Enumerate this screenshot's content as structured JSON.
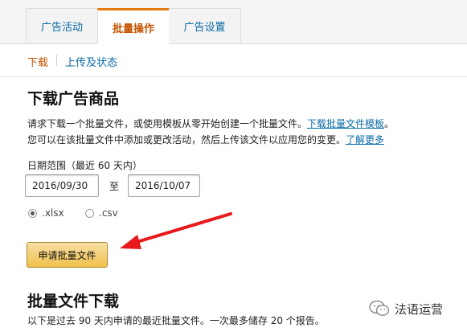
{
  "tabs": [
    {
      "label": "广告活动"
    },
    {
      "label": "批量操作"
    },
    {
      "label": "广告设置"
    }
  ],
  "subnav": {
    "active": "下载",
    "other": "上传及状态"
  },
  "download_section": {
    "title": "下载广告商品",
    "desc1_text": "请求下载一个批量文件，或使用模板从零开始创建一个批量文件。",
    "desc1_link": "下载批量文件模板",
    "desc1_tail": "。",
    "desc2_text": "您可以在该批量文件中添加或更改活动，然后上传该文件以应用您的变更。",
    "desc2_link": "了解更多",
    "date_range_label": "日期范围（最近 60 天内）",
    "start_date": "2016/09/30",
    "to_label": "至",
    "end_date": "2016/10/07",
    "format_xlsx": ".xlsx",
    "format_csv": ".csv",
    "selected_format": ".xlsx",
    "request_button": "申请批量文件"
  },
  "file_download_section": {
    "title": "批量文件下载",
    "desc": "以下是过去 90 天内申请的最近批量文件。一次最多储存 20 个报告。"
  },
  "watermark": {
    "text": "法语运营"
  }
}
